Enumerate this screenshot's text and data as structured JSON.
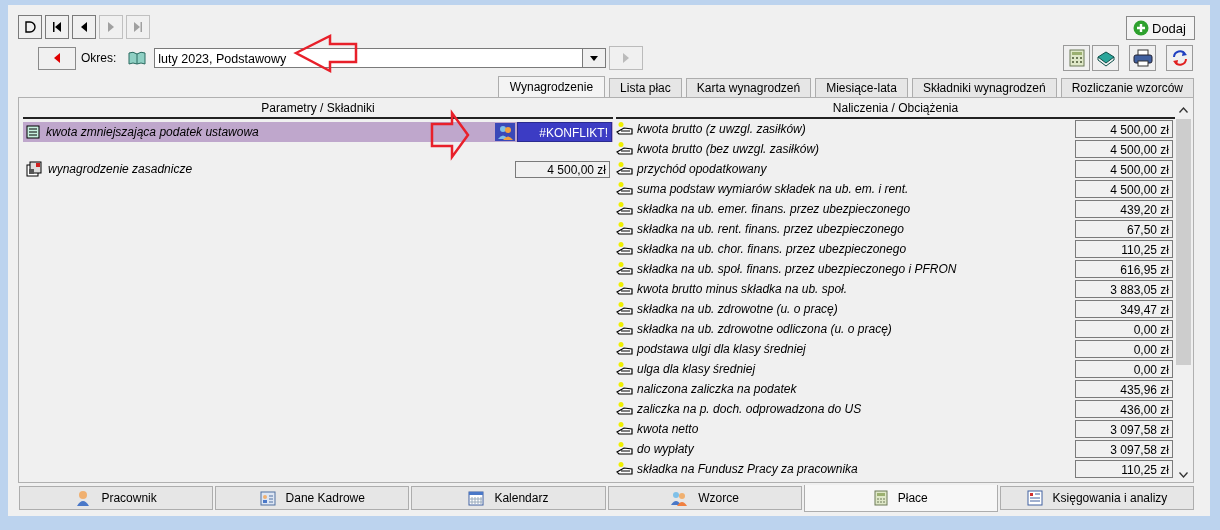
{
  "navigation": {
    "buttons": [
      {
        "kind": "new",
        "disabled": false
      },
      {
        "kind": "first",
        "disabled": false
      },
      {
        "kind": "prev",
        "disabled": false
      },
      {
        "kind": "next",
        "disabled": true
      },
      {
        "kind": "last",
        "disabled": true
      }
    ]
  },
  "add_button": {
    "label": "Dodaj"
  },
  "period": {
    "label": "Okres:",
    "value": "luty 2023, Podstawowy",
    "next_disabled": true
  },
  "tools": [
    {
      "kind": "calculator"
    },
    {
      "kind": "book"
    },
    {
      "kind": "printer"
    },
    {
      "kind": "refresh"
    }
  ],
  "tabs": [
    {
      "label": "Wynagrodzenie",
      "selected": true
    },
    {
      "label": "Lista płac",
      "selected": false
    },
    {
      "label": "Karta wynagrodzeń",
      "selected": false
    },
    {
      "label": "Miesiące-lata",
      "selected": false
    },
    {
      "label": "Składniki wynagrodzeń",
      "selected": false
    },
    {
      "label": "Rozliczanie wzorców",
      "selected": false
    }
  ],
  "parameters": {
    "header": "Parametry / Składniki",
    "items": [
      {
        "kind": "form",
        "label": "kwota zmniejszająca podatek ustawowa",
        "value": "#KONFLIKT!",
        "selected": true,
        "badge": true
      },
      {
        "kind": "component",
        "label": "wynagrodzenie zasadnicze",
        "value": "4 500,00 zł",
        "selected": false,
        "badge": false
      }
    ]
  },
  "charges": {
    "header": "Naliczenia / Obciążenia",
    "items": [
      {
        "label": "kwota brutto (z uwzgl. zasiłków)",
        "value": "4 500,00 zł"
      },
      {
        "label": "kwota brutto (bez uwzgl. zasiłków)",
        "value": "4 500,00 zł"
      },
      {
        "label": "przychód opodatkowany",
        "value": "4 500,00 zł"
      },
      {
        "label": "suma podstaw wymiarów składek na ub. em. i rent.",
        "value": "4 500,00 zł"
      },
      {
        "label": "składka na ub. emer. finans. przez ubezpieczonego",
        "value": "439,20 zł"
      },
      {
        "label": "składka na ub. rent. finans. przez ubezpieczonego",
        "value": "67,50 zł"
      },
      {
        "label": "składka na ub. chor. finans. przez ubezpieczonego",
        "value": "110,25 zł"
      },
      {
        "label": "składka na ub. społ. finans. przez ubezpieczonego i PFRON",
        "value": "616,95 zł"
      },
      {
        "label": "kwota brutto minus składka na ub. społ.",
        "value": "3 883,05 zł"
      },
      {
        "label": "składka na ub. zdrowotne (u. o pracę)",
        "value": "349,47 zł"
      },
      {
        "label": "składka na ub. zdrowotne odliczona (u. o pracę)",
        "value": "0,00 zł"
      },
      {
        "label": "podstawa ulgi dla klasy średniej",
        "value": "0,00 zł"
      },
      {
        "label": "ulga dla klasy średniej",
        "value": "0,00 zł"
      },
      {
        "label": "naliczona zaliczka na podatek",
        "value": "435,96 zł"
      },
      {
        "label": "zaliczka na p. doch. odprowadzona do US",
        "value": "436,00 zł"
      },
      {
        "label": "kwota netto",
        "value": "3 097,58 zł"
      },
      {
        "label": "do wypłaty",
        "value": "3 097,58 zł"
      },
      {
        "label": "składka na Fundusz Pracy za pracownika",
        "value": "110,25 zł"
      }
    ]
  },
  "bottom_tabs": [
    {
      "label": "Pracownik",
      "kind": "person",
      "selected": false
    },
    {
      "label": "Dane Kadrowe",
      "kind": "card",
      "selected": false
    },
    {
      "label": "Kalendarz",
      "kind": "calendar",
      "selected": false
    },
    {
      "label": "Wzorce",
      "kind": "people",
      "selected": false
    },
    {
      "label": "Płace",
      "kind": "calculator",
      "selected": true
    },
    {
      "label": "Księgowania i analizy",
      "kind": "ledger",
      "selected": false
    }
  ]
}
